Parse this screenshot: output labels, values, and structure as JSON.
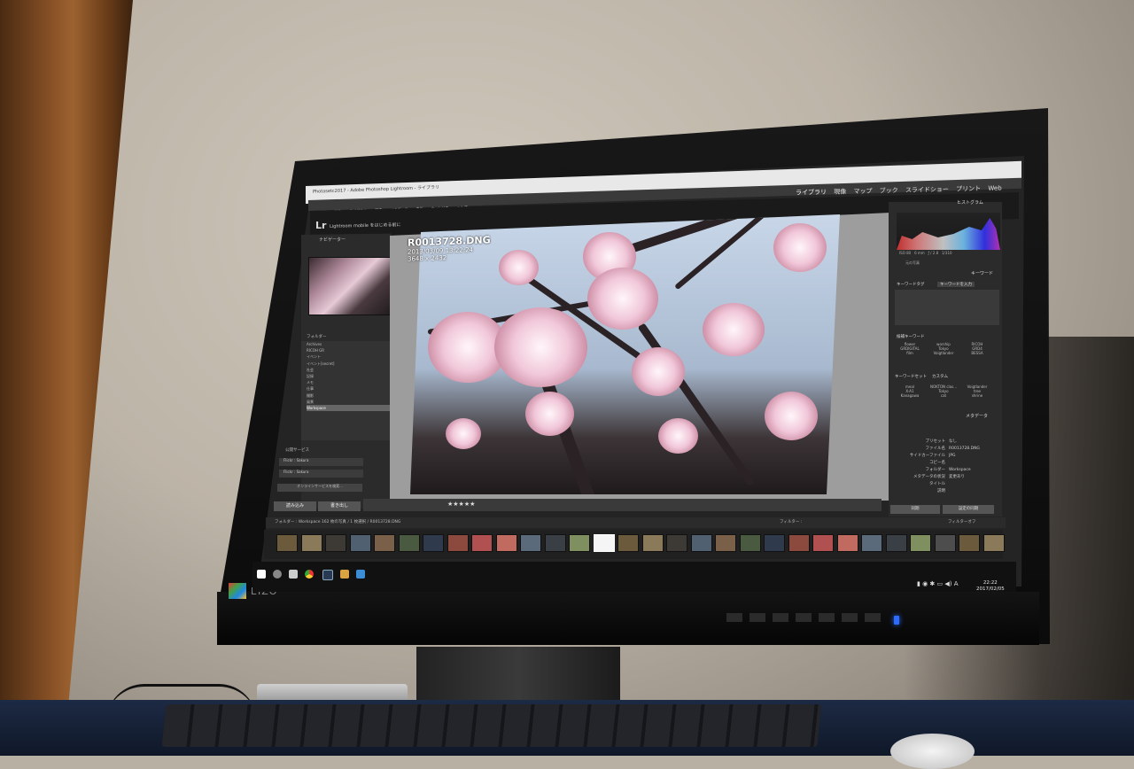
{
  "monitor": {
    "brand": "EIZO"
  },
  "app": {
    "titlebar": "Photosetc2017 - Adobe Photoshop Lightroom - ライブラリ",
    "menubar": [
      "ファイル",
      "編集",
      "ライブラリ",
      "写真",
      "メタデータ",
      "表示",
      "ウィンドウ",
      "ヘルプ"
    ],
    "logo": "Lr",
    "mobile_prompt": "Lightroom mobile をはじめる前に",
    "modules": [
      "ライブラリ",
      "現像",
      "マップ",
      "ブック",
      "スライドショー",
      "プリント",
      "Web"
    ],
    "active_module": "ライブラリ"
  },
  "left_panel": {
    "navigator_label": "ナビゲーター",
    "folders_label": "フォルダー",
    "folders": [
      "Archives",
      "RICOH GR",
      "イベント",
      "イベント[secret]",
      "社会",
      "記録",
      "メモ",
      "仕事",
      "撮影",
      "風景",
      "Workspace"
    ],
    "services_label": "公開サービス",
    "services": [
      "Flickr : Sakura",
      "Flickr : Sakura"
    ],
    "find_services": "オンラインサービスを検索...",
    "import_label": "読み込み",
    "export_label": "書き出し"
  },
  "photo": {
    "filename": "R0013728.DNG",
    "datetime": "2013/03/09 13:22:24",
    "dimensions": "3648 x 2432",
    "rating_stars": "★★★★★"
  },
  "right_panel": {
    "histogram_label": "ヒストグラム",
    "exif": [
      "ISO 80",
      "6 mm",
      "ƒ / 2.8",
      "1/310"
    ],
    "original_photo": "元の写真",
    "keywords_label": "キーワード",
    "keyword_tags_label": "キーワードタグ",
    "keyword_input_placeholder": "キーワードを入力",
    "suggested_label": "候補キーワード",
    "suggested": [
      "flower",
      "worship",
      "RICOH",
      "GRDIGITAL",
      "Tokyo",
      "GRD4",
      "film",
      "Voigtlander",
      "BESSA"
    ],
    "keyword_set_label": "キーワードセット",
    "keyword_set_value": "カスタム",
    "keyword_set": [
      "meal",
      "NOKTON clas...",
      "Voigtlander",
      "X-A1",
      "Tokyo",
      "tree",
      "Kanagawa",
      "cat",
      "shrine"
    ],
    "metadata_label": "メタデータ",
    "metadata": [
      {
        "k": "プリセット",
        "v": "なし"
      },
      {
        "k": "ファイル名",
        "v": "R0013728.DNG"
      },
      {
        "k": "サイドカーファイル",
        "v": "JPG"
      },
      {
        "k": "コピー名",
        "v": ""
      },
      {
        "k": "フォルダー",
        "v": "Workspace"
      },
      {
        "k": "メタデータの状況",
        "v": "変更あり"
      },
      {
        "k": "タイトル",
        "v": ""
      },
      {
        "k": "説明",
        "v": ""
      }
    ],
    "sync_label": "同期",
    "sync_settings_label": "設定の同期"
  },
  "filmstrip": {
    "path": "フォルダー : Workspace  162 枚の写真 / 1 枚選択 / R0013728.DNG",
    "filter_label": "フィルター :",
    "filter_off": "フィルターオフ"
  },
  "taskbar": {
    "clock_time": "22:22",
    "clock_date": "2017/02/05",
    "ime": "A"
  }
}
